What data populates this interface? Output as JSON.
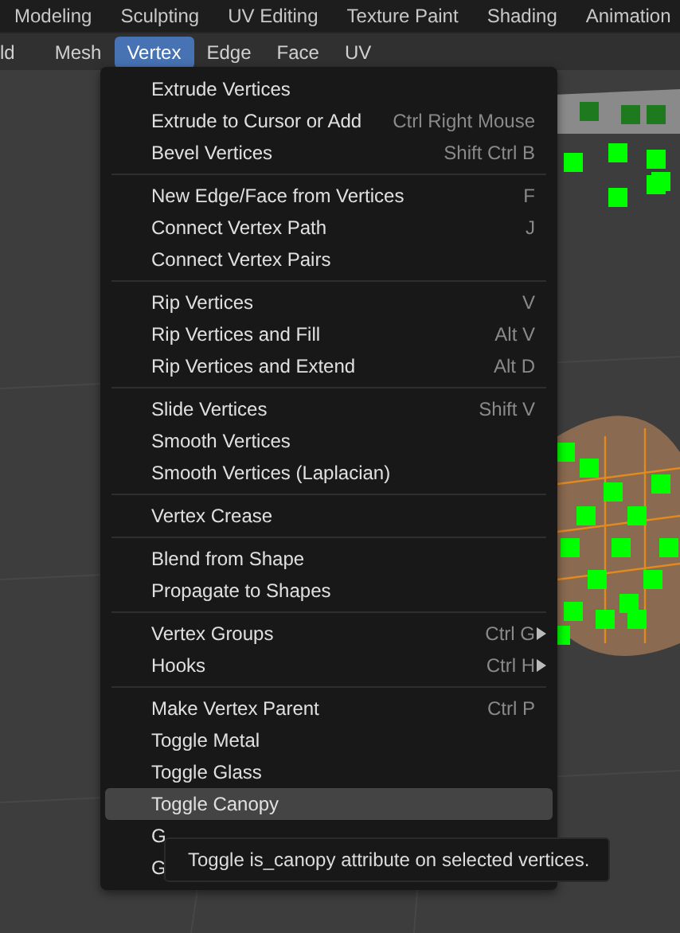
{
  "workspace_tabs": [
    {
      "label": "Modeling"
    },
    {
      "label": "Sculpting"
    },
    {
      "label": "UV Editing"
    },
    {
      "label": "Texture Paint"
    },
    {
      "label": "Shading"
    },
    {
      "label": "Animation"
    }
  ],
  "header_menus": [
    {
      "label": "ld",
      "selected": false
    },
    {
      "label": "Mesh",
      "selected": false
    },
    {
      "label": "Vertex",
      "selected": true
    },
    {
      "label": "Edge",
      "selected": false
    },
    {
      "label": "Face",
      "selected": false
    },
    {
      "label": "UV",
      "selected": false
    }
  ],
  "menu": {
    "sections": [
      [
        {
          "label": "Extrude Vertices",
          "selected": false
        },
        {
          "label": "Extrude to Cursor or Add",
          "shortcut": "Ctrl Right Mouse",
          "selected": false
        },
        {
          "label": "Bevel Vertices",
          "shortcut": "Shift Ctrl B",
          "selected": false
        }
      ],
      [
        {
          "label": "New Edge/Face from Vertices",
          "shortcut": "F",
          "selected": false
        },
        {
          "label": "Connect Vertex Path",
          "shortcut": "J",
          "selected": false
        },
        {
          "label": "Connect Vertex Pairs",
          "selected": false
        }
      ],
      [
        {
          "label": "Rip Vertices",
          "shortcut": "V",
          "selected": false
        },
        {
          "label": "Rip Vertices and Fill",
          "shortcut": "Alt V",
          "selected": false
        },
        {
          "label": "Rip Vertices and Extend",
          "shortcut": "Alt D",
          "selected": false
        }
      ],
      [
        {
          "label": "Slide Vertices",
          "shortcut": "Shift V",
          "selected": false
        },
        {
          "label": "Smooth Vertices",
          "selected": false
        },
        {
          "label": "Smooth Vertices (Laplacian)",
          "selected": false
        }
      ],
      [
        {
          "label": "Vertex Crease",
          "selected": false
        }
      ],
      [
        {
          "label": "Blend from Shape",
          "selected": false
        },
        {
          "label": "Propagate to Shapes",
          "selected": false
        }
      ],
      [
        {
          "label": "Vertex Groups",
          "shortcut": "Ctrl G",
          "submenu": true,
          "selected": false
        },
        {
          "label": "Hooks",
          "shortcut": "Ctrl H",
          "submenu": true,
          "selected": false
        }
      ],
      [
        {
          "label": "Make Vertex Parent",
          "shortcut": "Ctrl P",
          "selected": false
        },
        {
          "label": "Toggle Metal",
          "selected": false
        },
        {
          "label": "Toggle Glass",
          "selected": false
        },
        {
          "label": "Toggle Canopy",
          "selected": true
        },
        {
          "label": "G",
          "selected": false
        },
        {
          "label": "G",
          "selected": false
        }
      ]
    ]
  },
  "tooltip": {
    "text": "Toggle is_canopy attribute on selected vertices."
  }
}
